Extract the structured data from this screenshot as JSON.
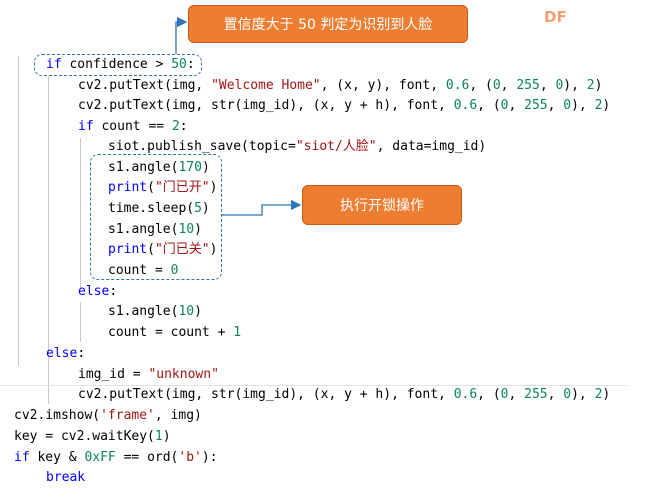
{
  "annotations": {
    "callout_confidence": "置信度大于 50 判定为识别到人脸",
    "callout_unlock": "执行开锁操作",
    "corner_tag": "DF"
  },
  "colors": {
    "keyword": "#0000ff",
    "string": "#a31515",
    "number": "#098658",
    "callout_fill": "#ed7d31",
    "dash_border": "#2e75b6"
  },
  "icons": [
    "arrow-right-icon"
  ],
  "code_lines": [
    [
      {
        "t": "kw",
        "s": "if"
      },
      {
        "t": "plain",
        "s": " confidence > "
      },
      {
        "t": "num",
        "s": "50"
      },
      {
        "t": "plain",
        "s": ":"
      }
    ],
    [
      {
        "t": "plain",
        "s": "cv2.putText(img, "
      },
      {
        "t": "str",
        "s": "\"Welcome Home\""
      },
      {
        "t": "plain",
        "s": ", (x, y), font, "
      },
      {
        "t": "num",
        "s": "0.6"
      },
      {
        "t": "plain",
        "s": ", ("
      },
      {
        "t": "num",
        "s": "0"
      },
      {
        "t": "plain",
        "s": ", "
      },
      {
        "t": "num",
        "s": "255"
      },
      {
        "t": "plain",
        "s": ", "
      },
      {
        "t": "num",
        "s": "0"
      },
      {
        "t": "plain",
        "s": "), "
      },
      {
        "t": "num",
        "s": "2"
      },
      {
        "t": "plain",
        "s": ")"
      }
    ],
    [
      {
        "t": "plain",
        "s": "cv2.putText(img, str(img_id), (x, y + h), font, "
      },
      {
        "t": "num",
        "s": "0.6"
      },
      {
        "t": "plain",
        "s": ", ("
      },
      {
        "t": "num",
        "s": "0"
      },
      {
        "t": "plain",
        "s": ", "
      },
      {
        "t": "num",
        "s": "255"
      },
      {
        "t": "plain",
        "s": ", "
      },
      {
        "t": "num",
        "s": "0"
      },
      {
        "t": "plain",
        "s": "), "
      },
      {
        "t": "num",
        "s": "2"
      },
      {
        "t": "plain",
        "s": ")"
      }
    ],
    [
      {
        "t": "kw",
        "s": "if"
      },
      {
        "t": "plain",
        "s": " count == "
      },
      {
        "t": "num",
        "s": "2"
      },
      {
        "t": "plain",
        "s": ":"
      }
    ],
    [
      {
        "t": "plain",
        "s": "siot.publish_save(topic="
      },
      {
        "t": "str",
        "s": "\"siot/人脸\""
      },
      {
        "t": "plain",
        "s": ", data=img_id)"
      }
    ],
    [
      {
        "t": "plain",
        "s": "s1.angle("
      },
      {
        "t": "num",
        "s": "170"
      },
      {
        "t": "plain",
        "s": ")"
      }
    ],
    [
      {
        "t": "kw",
        "s": "print"
      },
      {
        "t": "plain",
        "s": "("
      },
      {
        "t": "str",
        "s": "\"门已开\""
      },
      {
        "t": "plain",
        "s": ")"
      }
    ],
    [
      {
        "t": "plain",
        "s": "time.sleep("
      },
      {
        "t": "num",
        "s": "5"
      },
      {
        "t": "plain",
        "s": ")"
      }
    ],
    [
      {
        "t": "plain",
        "s": "s1.angle("
      },
      {
        "t": "num",
        "s": "10"
      },
      {
        "t": "plain",
        "s": ")"
      }
    ],
    [
      {
        "t": "kw",
        "s": "print"
      },
      {
        "t": "plain",
        "s": "("
      },
      {
        "t": "str",
        "s": "\"门已关\""
      },
      {
        "t": "plain",
        "s": ")"
      }
    ],
    [
      {
        "t": "plain",
        "s": "count = "
      },
      {
        "t": "num",
        "s": "0"
      }
    ],
    [
      {
        "t": "kw",
        "s": "else"
      },
      {
        "t": "plain",
        "s": ":"
      }
    ],
    [
      {
        "t": "plain",
        "s": "s1.angle("
      },
      {
        "t": "num",
        "s": "10"
      },
      {
        "t": "plain",
        "s": ")"
      }
    ],
    [
      {
        "t": "plain",
        "s": "count = count + "
      },
      {
        "t": "num",
        "s": "1"
      }
    ],
    [
      {
        "t": "kw",
        "s": "else"
      },
      {
        "t": "plain",
        "s": ":"
      }
    ],
    [
      {
        "t": "plain",
        "s": "img_id = "
      },
      {
        "t": "str",
        "s": "\"unknown\""
      }
    ],
    [
      {
        "t": "plain",
        "s": "cv2.putText(img, str(img_id), (x, y + h), font, "
      },
      {
        "t": "num",
        "s": "0.6"
      },
      {
        "t": "plain",
        "s": ", ("
      },
      {
        "t": "num",
        "s": "0"
      },
      {
        "t": "plain",
        "s": ", "
      },
      {
        "t": "num",
        "s": "255"
      },
      {
        "t": "plain",
        "s": ", "
      },
      {
        "t": "num",
        "s": "0"
      },
      {
        "t": "plain",
        "s": "), "
      },
      {
        "t": "num",
        "s": "2"
      },
      {
        "t": "plain",
        "s": ")"
      }
    ],
    [
      {
        "t": "plain",
        "s": "cv2.imshow("
      },
      {
        "t": "str",
        "s": "'frame'"
      },
      {
        "t": "plain",
        "s": ", img)"
      }
    ],
    [
      {
        "t": "plain",
        "s": "key = cv2.waitKey("
      },
      {
        "t": "num",
        "s": "1"
      },
      {
        "t": "plain",
        "s": ")"
      }
    ],
    [
      {
        "t": "kw",
        "s": "if"
      },
      {
        "t": "plain",
        "s": " key & "
      },
      {
        "t": "num",
        "s": "0xFF"
      },
      {
        "t": "plain",
        "s": " == ord("
      },
      {
        "t": "str",
        "s": "'b'"
      },
      {
        "t": "plain",
        "s": "):"
      }
    ],
    [
      {
        "t": "kw",
        "s": "break"
      }
    ]
  ]
}
